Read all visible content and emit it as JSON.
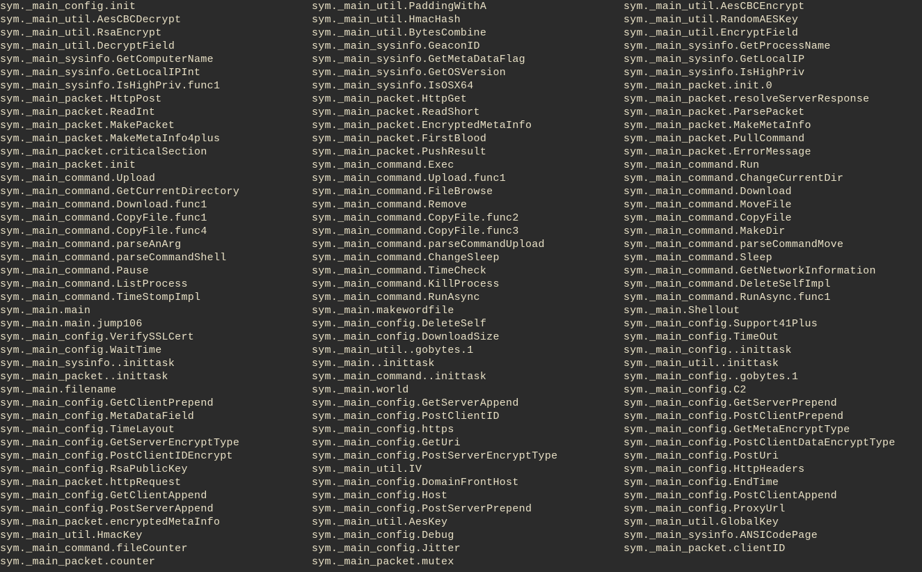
{
  "columns": [
    [
      "sym._main_config.init",
      "sym._main_util.AesCBCDecrypt",
      "sym._main_util.RsaEncrypt",
      "sym._main_util.DecryptField",
      "sym._main_sysinfo.GetComputerName",
      "sym._main_sysinfo.GetLocalIPInt",
      "sym._main_sysinfo.IsHighPriv.func1",
      "sym._main_packet.HttpPost",
      "sym._main_packet.ReadInt",
      "sym._main_packet.MakePacket",
      "sym._main_packet.MakeMetaInfo4plus",
      "sym._main_packet.criticalSection",
      "sym._main_packet.init",
      "sym._main_command.Upload",
      "sym._main_command.GetCurrentDirectory",
      "sym._main_command.Download.func1",
      "sym._main_command.CopyFile.func1",
      "sym._main_command.CopyFile.func4",
      "sym._main_command.parseAnArg",
      "sym._main_command.parseCommandShell",
      "sym._main_command.Pause",
      "sym._main_command.ListProcess",
      "sym._main_command.TimeStompImpl",
      "sym._main.main",
      "sym._main.main.jump106",
      "sym._main_config.VerifySSLCert",
      "sym._main_config.WaitTime",
      "sym._main_sysinfo..inittask",
      "sym._main_packet..inittask",
      "sym._main.filename",
      "sym._main_config.GetClientPrepend",
      "sym._main_config.MetaDataField",
      "sym._main_config.TimeLayout",
      "sym._main_config.GetServerEncryptType",
      "sym._main_config.PostClientIDEncrypt",
      "sym._main_config.RsaPublicKey",
      "sym._main_packet.httpRequest",
      "sym._main_config.GetClientAppend",
      "sym._main_config.PostServerAppend",
      "sym._main_packet.encryptedMetaInfo",
      "sym._main_util.HmacKey",
      "sym._main_command.fileCounter",
      "sym._main_packet.counter"
    ],
    [
      "sym._main_util.PaddingWithA",
      "sym._main_util.HmacHash",
      "sym._main_util.BytesCombine",
      "sym._main_sysinfo.GeaconID",
      "sym._main_sysinfo.GetMetaDataFlag",
      "sym._main_sysinfo.GetOSVersion",
      "sym._main_sysinfo.IsOSX64",
      "sym._main_packet.HttpGet",
      "sym._main_packet.ReadShort",
      "sym._main_packet.EncryptedMetaInfo",
      "sym._main_packet.FirstBlood",
      "sym._main_packet.PushResult",
      "sym._main_command.Exec",
      "sym._main_command.Upload.func1",
      "sym._main_command.FileBrowse",
      "sym._main_command.Remove",
      "sym._main_command.CopyFile.func2",
      "sym._main_command.CopyFile.func3",
      "sym._main_command.parseCommandUpload",
      "sym._main_command.ChangeSleep",
      "sym._main_command.TimeCheck",
      "sym._main_command.KillProcess",
      "sym._main_command.RunAsync",
      "sym._main.makewordfile",
      "sym._main_config.DeleteSelf",
      "sym._main_config.DownloadSize",
      "sym._main_util..gobytes.1",
      "sym._main..inittask",
      "sym._main_command..inittask",
      "sym._main.world",
      "sym._main_config.GetServerAppend",
      "sym._main_config.PostClientID",
      "sym._main_config.https",
      "sym._main_config.GetUri",
      "sym._main_config.PostServerEncryptType",
      "sym._main_util.IV",
      "sym._main_config.DomainFrontHost",
      "sym._main_config.Host",
      "sym._main_config.PostServerPrepend",
      "sym._main_util.AesKey",
      "sym._main_config.Debug",
      "sym._main_config.Jitter",
      "sym._main_packet.mutex"
    ],
    [
      "sym._main_util.AesCBCEncrypt",
      "sym._main_util.RandomAESKey",
      "sym._main_util.EncryptField",
      "sym._main_sysinfo.GetProcessName",
      "sym._main_sysinfo.GetLocalIP",
      "sym._main_sysinfo.IsHighPriv",
      "sym._main_packet.init.0",
      "sym._main_packet.resolveServerResponse",
      "sym._main_packet.ParsePacket",
      "sym._main_packet.MakeMetaInfo",
      "sym._main_packet.PullCommand",
      "sym._main_packet.ErrorMessage",
      "sym._main_command.Run",
      "sym._main_command.ChangeCurrentDir",
      "sym._main_command.Download",
      "sym._main_command.MoveFile",
      "sym._main_command.CopyFile",
      "sym._main_command.MakeDir",
      "sym._main_command.parseCommandMove",
      "sym._main_command.Sleep",
      "sym._main_command.GetNetworkInformation",
      "sym._main_command.DeleteSelfImpl",
      "sym._main_command.RunAsync.func1",
      "sym._main.Shellout",
      "sym._main_config.Support41Plus",
      "sym._main_config.TimeOut",
      "sym._main_config..inittask",
      "sym._main_util..inittask",
      "sym._main_config..gobytes.1",
      "sym._main_config.C2",
      "sym._main_config.GetServerPrepend",
      "sym._main_config.PostClientPrepend",
      "sym._main_config.GetMetaEncryptType",
      "sym._main_config.PostClientDataEncryptType",
      "sym._main_config.PostUri",
      "sym._main_config.HttpHeaders",
      "sym._main_config.EndTime",
      "sym._main_config.PostClientAppend",
      "sym._main_config.ProxyUrl",
      "sym._main_util.GlobalKey",
      "sym._main_sysinfo.ANSICodePage",
      "sym._main_packet.clientID"
    ]
  ]
}
